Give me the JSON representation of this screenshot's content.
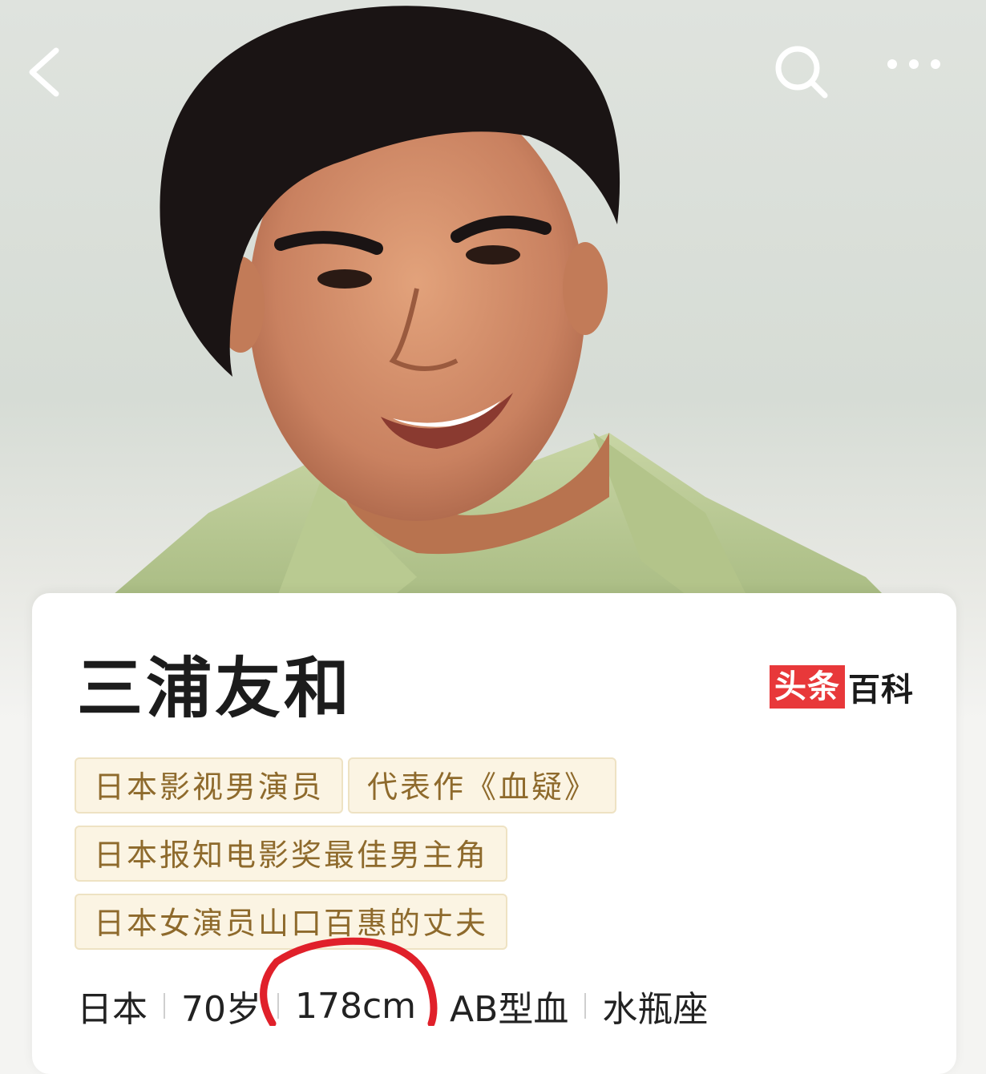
{
  "nav": {
    "back_icon": "chevron-left-icon",
    "search_icon": "search-icon",
    "more_icon": "more-dots-icon"
  },
  "profile": {
    "name": "三浦友和",
    "brand_part1": "头条",
    "brand_part2": "百科",
    "tags": [
      "日本影视男演员",
      "代表作《血疑》",
      "日本报知电影奖最佳男主角",
      "日本女演员山口百惠的丈夫"
    ],
    "facts": [
      "日本",
      "70岁",
      "178cm",
      "AB型血",
      "水瓶座"
    ]
  },
  "colors": {
    "brand_red": "#e8383a",
    "tag_bg": "#fbf4e3",
    "tag_text": "#8e6a2c",
    "annotation_circle": "#e0202a"
  }
}
